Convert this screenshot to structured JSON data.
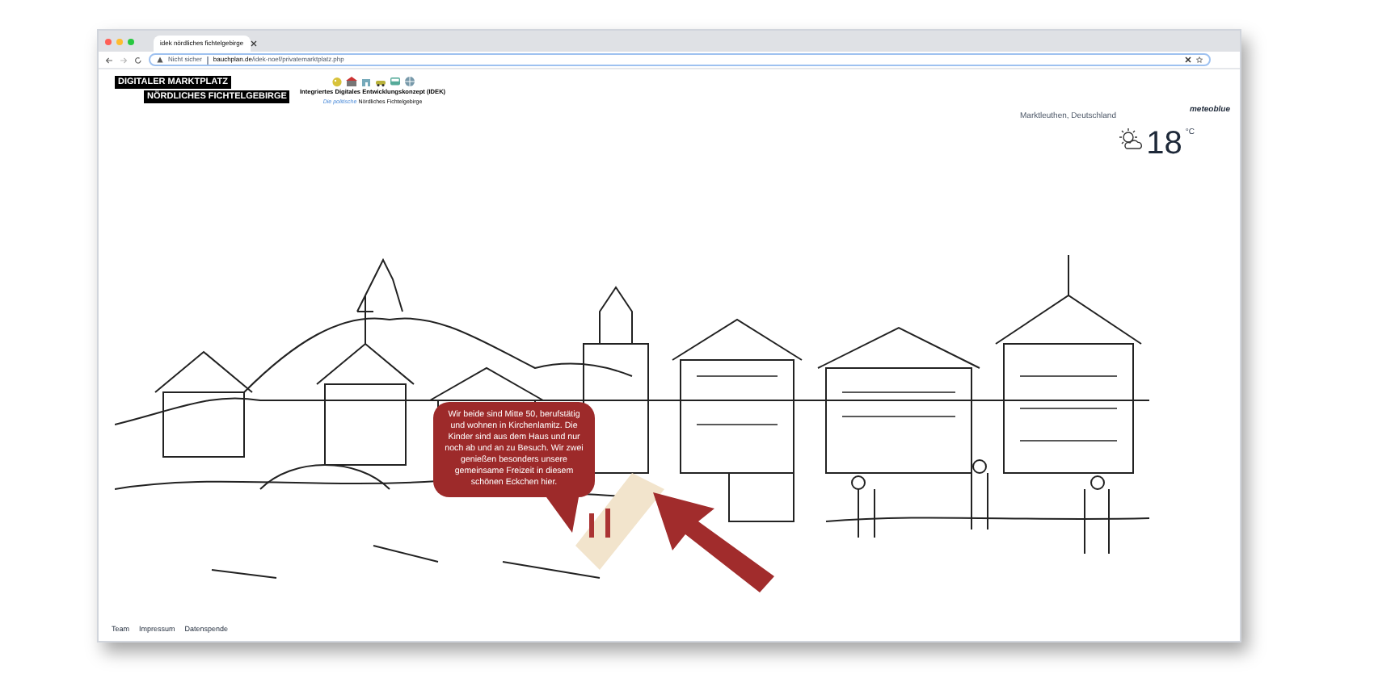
{
  "browser": {
    "tab_title": "idek nördliches fichtelgebirge",
    "security": "Nicht sicher",
    "url_domain": "bauchplan.de",
    "url_path": "/idek-noef/privatemarktplatz.php"
  },
  "logo": {
    "line_1": "DIGITALER MARKTPLATZ",
    "line_2": "NÖRDLICHES FICHTELGEBIRGE"
  },
  "project": {
    "title": "Integriertes Digitales Entwicklungskonzept (IDEK)",
    "prefix": "Die politische",
    "region": "Nördliches Fichtelgebirge"
  },
  "weather": {
    "location": "Marktleuthen, Deutschland",
    "provider": "meteoblue",
    "temperature": "18",
    "unit": "°C"
  },
  "speech_bubble": {
    "text": "Wir beide sind Mitte 50, berufstätig und wohnen in Kirchenlamitz. Die Kinder sind aus dem Haus und nur noch ab und an zu Besuch. Wir zwei genießen besonders unsere gemeinsame Freizeit in diesem schönen Eckchen hier."
  },
  "footer_links": [
    "Team",
    "Impressum",
    "Datenspende"
  ]
}
